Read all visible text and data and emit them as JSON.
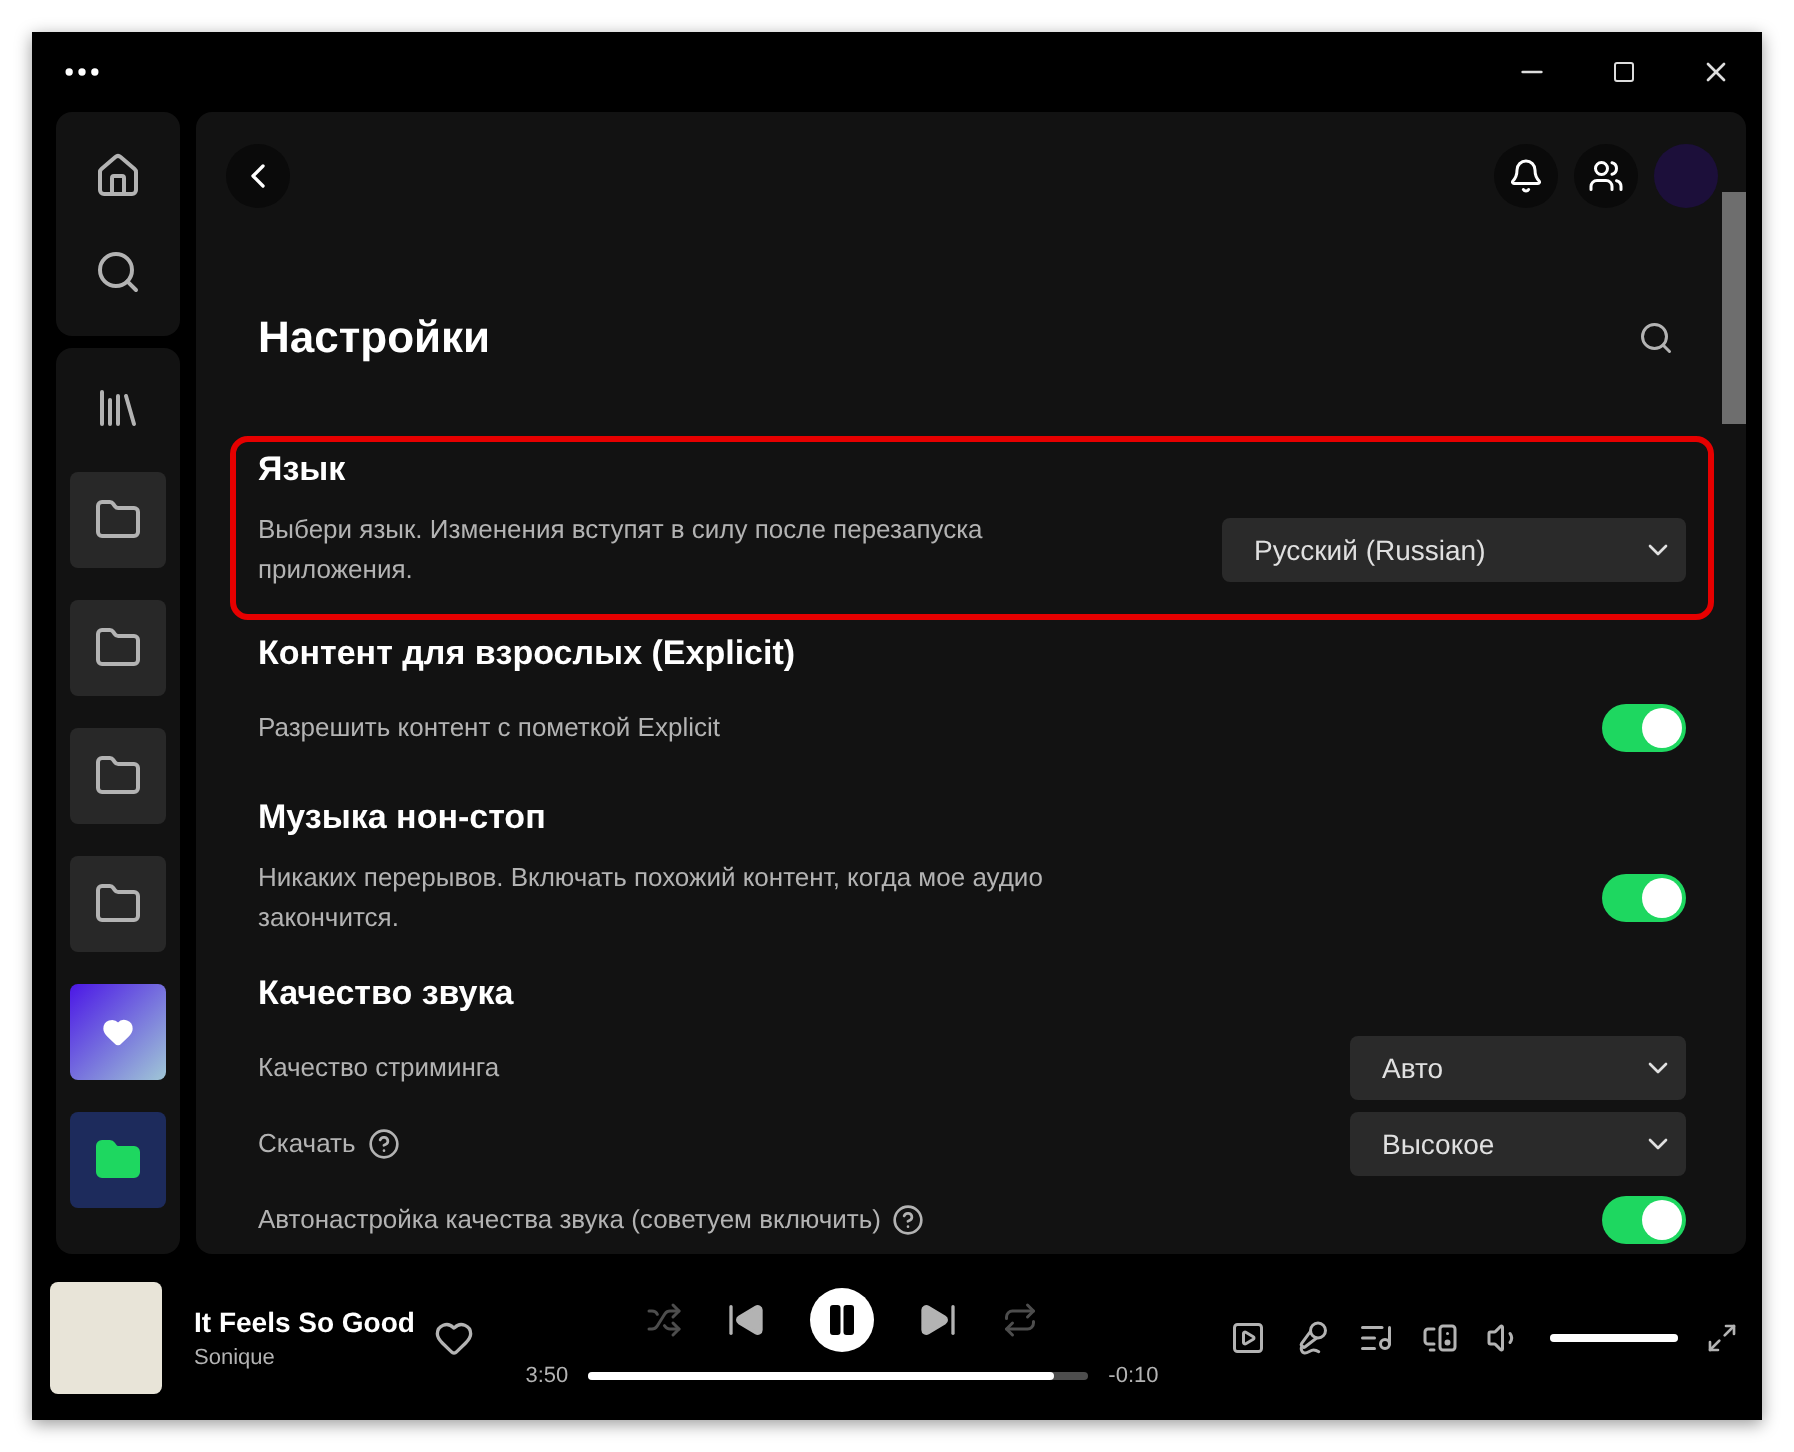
{
  "settings": {
    "title": "Настройки",
    "sections": [
      {
        "title": "Язык",
        "highlighted": true,
        "rows": [
          {
            "kind": "select",
            "label": "Выбери язык. Изменения вступят в силу после перезапуска приложения.",
            "value": "Русский (Russian)",
            "help": false,
            "wide": true
          }
        ]
      },
      {
        "title": "Контент для взрослых (Explicit)",
        "highlighted": false,
        "rows": [
          {
            "kind": "toggle",
            "label": "Разрешить контент с пометкой Explicit",
            "on": true,
            "help": false
          }
        ]
      },
      {
        "title": "Музыка нон-стоп",
        "highlighted": false,
        "rows": [
          {
            "kind": "toggle",
            "label": "Никаких перерывов. Включать похожий контент, когда мое аудио закончится.",
            "on": true,
            "help": false
          }
        ]
      },
      {
        "title": "Качество звука",
        "highlighted": false,
        "rows": [
          {
            "kind": "select",
            "label": "Качество стриминга",
            "value": "Авто",
            "help": false,
            "wide": false
          },
          {
            "kind": "select",
            "label": "Скачать",
            "value": "Высокое",
            "help": true,
            "wide": false
          },
          {
            "kind": "toggle",
            "label": "Автонастройка качества звука (советуем включить)",
            "on": true,
            "help": true
          }
        ]
      }
    ]
  },
  "player": {
    "track": "It Feels So Good",
    "artist": "Sonique",
    "liked": false,
    "playing": true,
    "shuffle": {
      "enabled": false
    },
    "repeat": {
      "enabled": false
    },
    "elapsed": "3:50",
    "remaining": "-0:10",
    "progress": {
      "level": 0.93
    },
    "volume": {
      "level": 1
    }
  }
}
